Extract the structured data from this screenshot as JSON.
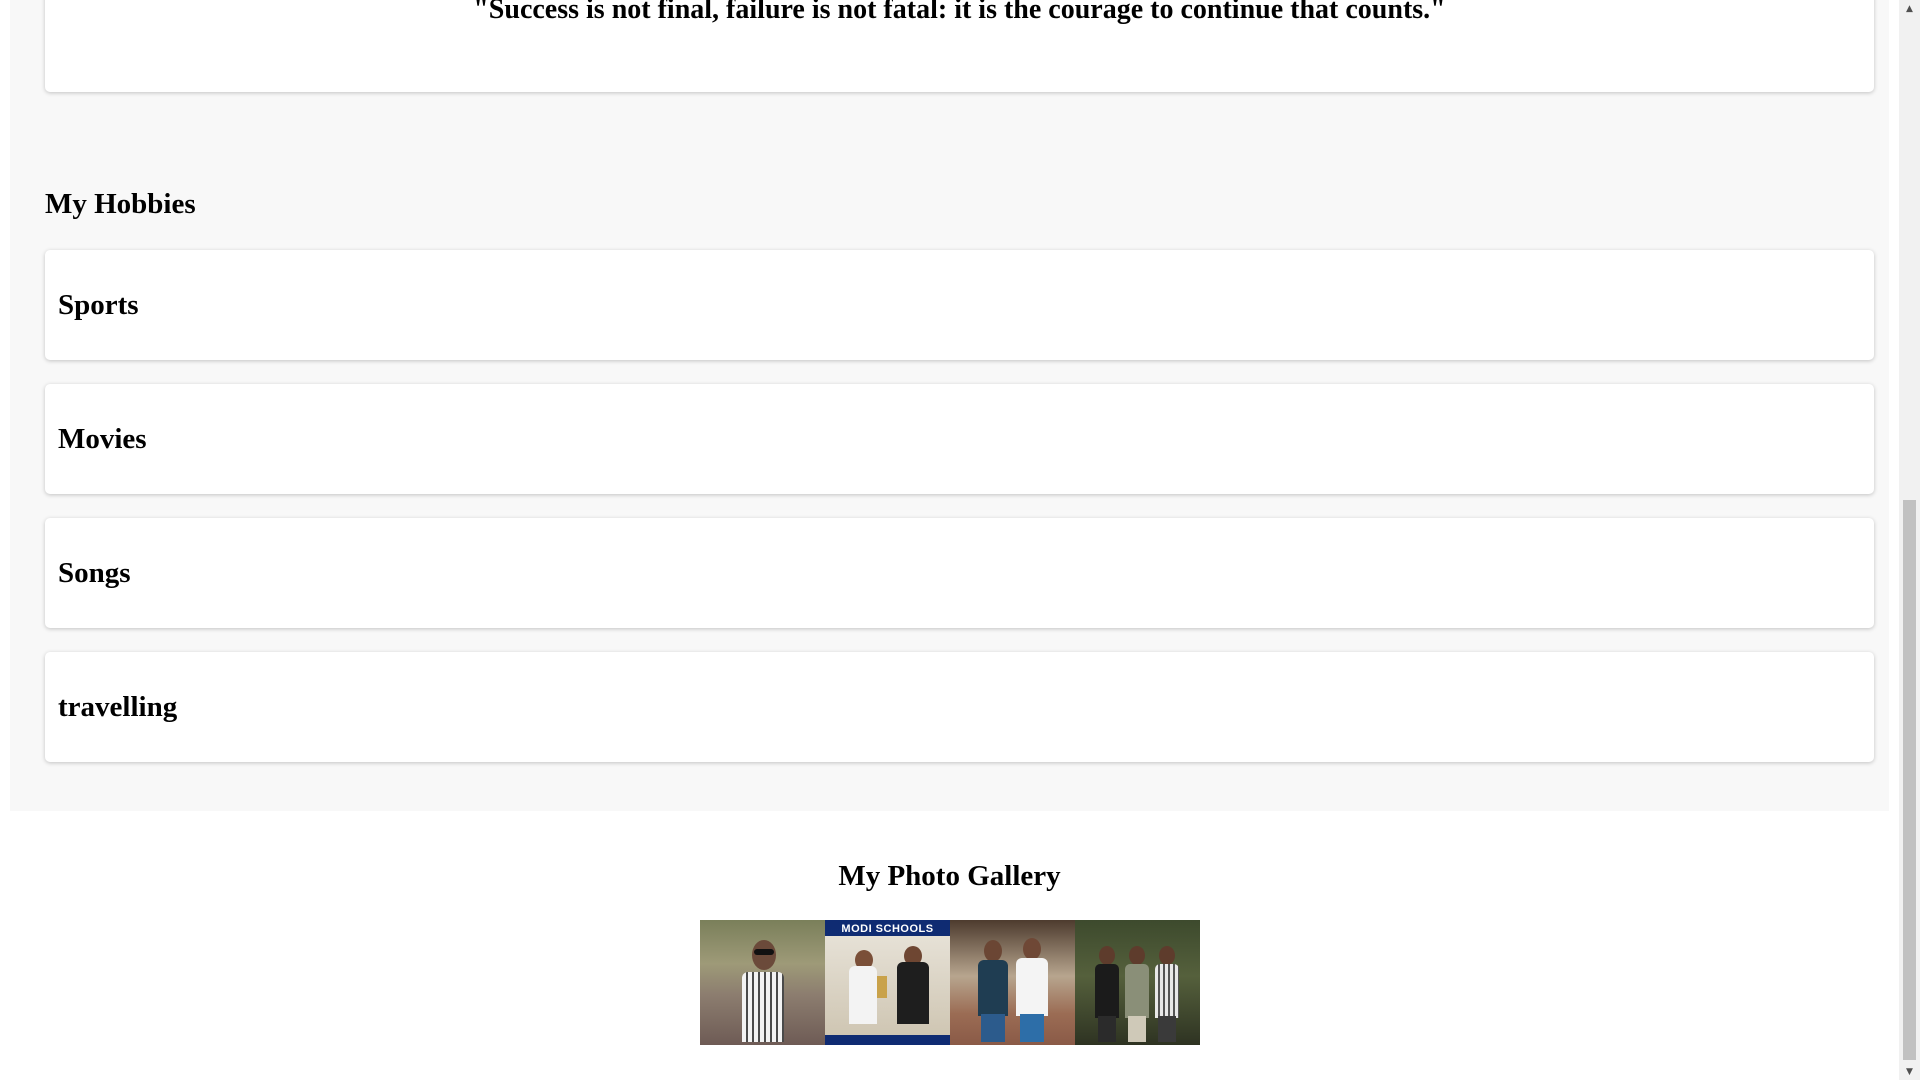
{
  "quote": {
    "text": "\"Success is not final, failure is not fatal: it is the courage to continue that counts.\""
  },
  "hobbies": {
    "title": "My Hobbies",
    "items": [
      {
        "label": "Sports"
      },
      {
        "label": "Movies"
      },
      {
        "label": "Songs"
      },
      {
        "label": "travelling"
      }
    ]
  },
  "gallery": {
    "title": "My Photo Gallery",
    "photos": [
      {
        "caption": ""
      },
      {
        "caption": "MODI SCHOOLS"
      },
      {
        "caption": ""
      },
      {
        "caption": ""
      }
    ]
  }
}
